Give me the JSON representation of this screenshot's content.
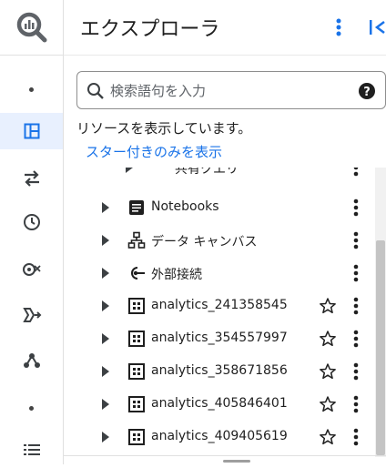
{
  "rail": {
    "items": [
      {
        "icon": "bigquery-logo-icon"
      },
      {
        "icon": "dot-icon"
      },
      {
        "icon": "explorer-panel-icon",
        "active": true
      },
      {
        "icon": "transfer-arrows-icon"
      },
      {
        "icon": "history-clock-icon"
      },
      {
        "icon": "scheduled-query-icon"
      },
      {
        "icon": "pipeline-icon"
      },
      {
        "icon": "graph-icon"
      },
      {
        "icon": "dot-icon"
      },
      {
        "icon": "list-icon"
      }
    ]
  },
  "header": {
    "title": "エクスプローラ"
  },
  "search": {
    "placeholder": "検索語句を入力"
  },
  "status_text": "リソースを表示しています。",
  "star_filter_link": "スター付きのみを表示",
  "tree": {
    "partial_label": "共有クエリ",
    "rows": [
      {
        "label": "Notebooks",
        "icon": "notebook-icon",
        "star": false
      },
      {
        "label": "データ キャンバス",
        "icon": "data-canvas-icon",
        "star": false
      },
      {
        "label": "外部接続",
        "icon": "external-connection-icon",
        "star": false
      },
      {
        "label": "analytics_241358545",
        "icon": "dataset-icon",
        "star": true
      },
      {
        "label": "analytics_354557997",
        "icon": "dataset-icon",
        "star": true
      },
      {
        "label": "analytics_358671856",
        "icon": "dataset-icon",
        "star": true
      },
      {
        "label": "analytics_405846401",
        "icon": "dataset-icon",
        "star": true
      },
      {
        "label": "analytics_409405619",
        "icon": "dataset-icon",
        "star": true
      }
    ]
  },
  "colors": {
    "accent": "#1a73e8",
    "active_bg": "#e8f0fe",
    "text": "#1f1f1f"
  }
}
